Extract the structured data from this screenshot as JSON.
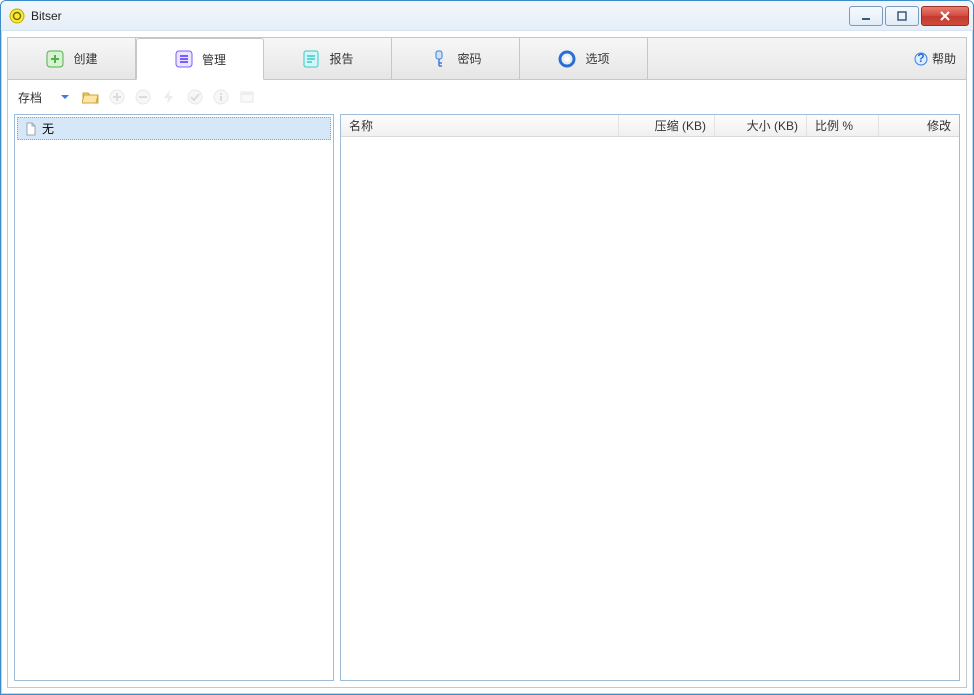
{
  "window": {
    "title": "Bitser"
  },
  "tabs": [
    {
      "label": "创建",
      "icon": "plus-box-icon",
      "color": "#4fb14a"
    },
    {
      "label": "管理",
      "icon": "list-box-icon",
      "color": "#7c5cff",
      "active": true
    },
    {
      "label": "报告",
      "icon": "report-icon",
      "color": "#37c9c9"
    },
    {
      "label": "密码",
      "icon": "key-icon",
      "color": "#3a7de0"
    },
    {
      "label": "选项",
      "icon": "ring-icon",
      "color": "#2a6fd6"
    }
  ],
  "help": {
    "label": "帮助"
  },
  "toolbar": {
    "archive_label": "存档",
    "buttons": [
      {
        "name": "dropdown",
        "icon": "chevron-down-icon",
        "enabled": true
      },
      {
        "name": "open",
        "icon": "folder-open-icon",
        "enabled": true
      },
      {
        "name": "add",
        "icon": "plus-circle-icon",
        "enabled": false
      },
      {
        "name": "remove",
        "icon": "minus-circle-icon",
        "enabled": false
      },
      {
        "name": "extract",
        "icon": "bolt-icon",
        "enabled": false
      },
      {
        "name": "test",
        "icon": "check-circle-icon",
        "enabled": false
      },
      {
        "name": "info",
        "icon": "info-circle-icon",
        "enabled": false
      },
      {
        "name": "props",
        "icon": "window-icon",
        "enabled": false
      }
    ]
  },
  "tree": {
    "root_label": "无"
  },
  "columns": {
    "name": "名称",
    "compressed": "压缩 (KB)",
    "size": "大小 (KB)",
    "ratio": "比例 %",
    "modified": "修改"
  }
}
